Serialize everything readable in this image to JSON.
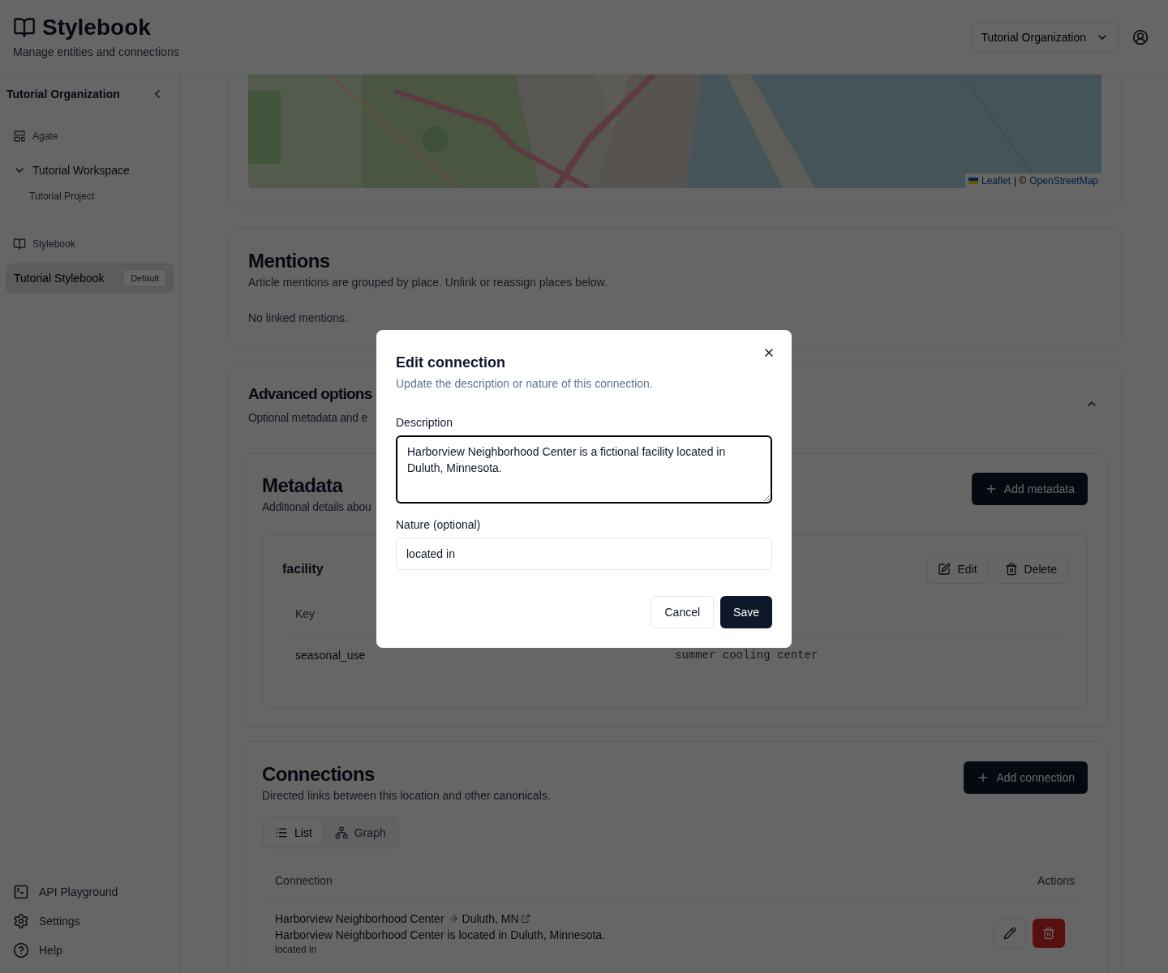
{
  "header": {
    "title": "Stylebook",
    "subtitle": "Manage entities and connections",
    "org_select": {
      "value": "Tutorial Organization"
    }
  },
  "sidebar": {
    "organization": "Tutorial Organization",
    "agate": "Agate",
    "workspaces": [
      {
        "label": "Tutorial Workspace",
        "expanded": true,
        "children": [
          {
            "label": "Tutorial Project"
          }
        ]
      }
    ],
    "stylebook_section": "Stylebook",
    "stylebooks": [
      {
        "label": "Tutorial Stylebook",
        "badge": "Default",
        "selected": true
      }
    ],
    "footer_links": [
      "API Playground",
      "Settings",
      "Help"
    ]
  },
  "map": {
    "attribution": {
      "leaflet": "Leaflet",
      "separator": "| ©",
      "osm": "OpenStreetMap"
    }
  },
  "mentions": {
    "title": "Mentions",
    "subtitle": "Article mentions are grouped by place. Unlink or reassign places below.",
    "empty": "No linked mentions."
  },
  "advanced": {
    "title": "Advanced options",
    "subtitle": "Optional metadata and e",
    "expanded": true
  },
  "metadata": {
    "title": "Metadata",
    "subtitle": "Additional details abou",
    "add_button": "Add metadata",
    "groups": [
      {
        "name": "facility",
        "edit": "Edit",
        "delete": "Delete",
        "key_header": "Key",
        "rows": [
          {
            "key": "seasonal_use",
            "value": "summer cooling center"
          }
        ]
      }
    ]
  },
  "connections": {
    "title": "Connections",
    "subtitle": "Directed links between this location and other canonicals.",
    "add_button": "Add connection",
    "views": [
      {
        "label": "List",
        "selected": true
      },
      {
        "label": "Graph",
        "selected": false
      }
    ],
    "columns": [
      "Connection",
      "Actions"
    ],
    "rows": [
      {
        "source": "Harborview Neighborhood Center",
        "target": "Duluth, MN",
        "description": "Harborview Neighborhood Center is located in Duluth, Minnesota.",
        "nature": "located in"
      }
    ]
  },
  "dialog": {
    "title": "Edit connection",
    "subtitle": "Update the description or nature of this connection.",
    "fields": [
      {
        "kind": "textarea",
        "label": "Description",
        "value": "Harborview Neighborhood Center is a fictional facility located in Duluth, Minnesota.",
        "focused": true
      },
      {
        "kind": "input",
        "label": "Nature (optional)",
        "value": "located in",
        "focused": false
      }
    ],
    "buttons": [
      {
        "label": "Cancel",
        "kind": "secondary"
      },
      {
        "label": "Save",
        "kind": "primary"
      }
    ]
  }
}
